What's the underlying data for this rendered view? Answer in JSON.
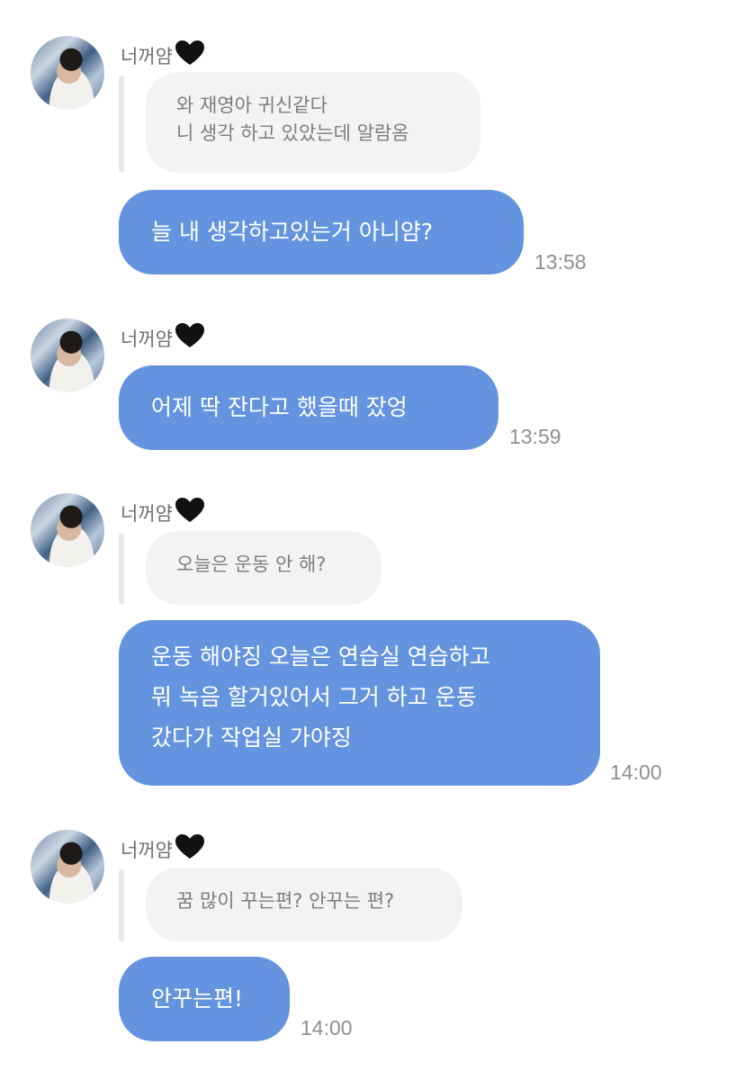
{
  "sender": {
    "name": "너꺼얌"
  },
  "messages": [
    {
      "quote": [
        "와 재영아 귀신같다",
        "니 생각 하고 있았는데 알람옴"
      ],
      "reply": [
        "늘 내 생각하고있는거 아니얌?"
      ],
      "time": "13:58"
    },
    {
      "reply": [
        "어제 딱 잔다고 했을때 잤엉"
      ],
      "time": "13:59"
    },
    {
      "quote": [
        "오늘은 운동 안 해?"
      ],
      "reply": [
        "운동 해야징 오늘은 연습실 연습하고",
        "뭐 녹음 할거있어서 그거 하고 운동",
        "갔다가 작업실 가야징"
      ],
      "time": "14:00"
    },
    {
      "quote": [
        "꿈 많이 꾸는편? 안꾸는 편?"
      ],
      "reply": [
        "안꾸는편!"
      ],
      "time": "14:00"
    }
  ],
  "colors": {
    "bubble": "#6494e0",
    "quote_bg": "#f3f3f5",
    "quote_text": "#7d7d80",
    "time_text": "#8f8f8f"
  },
  "icons": [
    "black-heart-icon",
    "avatar"
  ]
}
